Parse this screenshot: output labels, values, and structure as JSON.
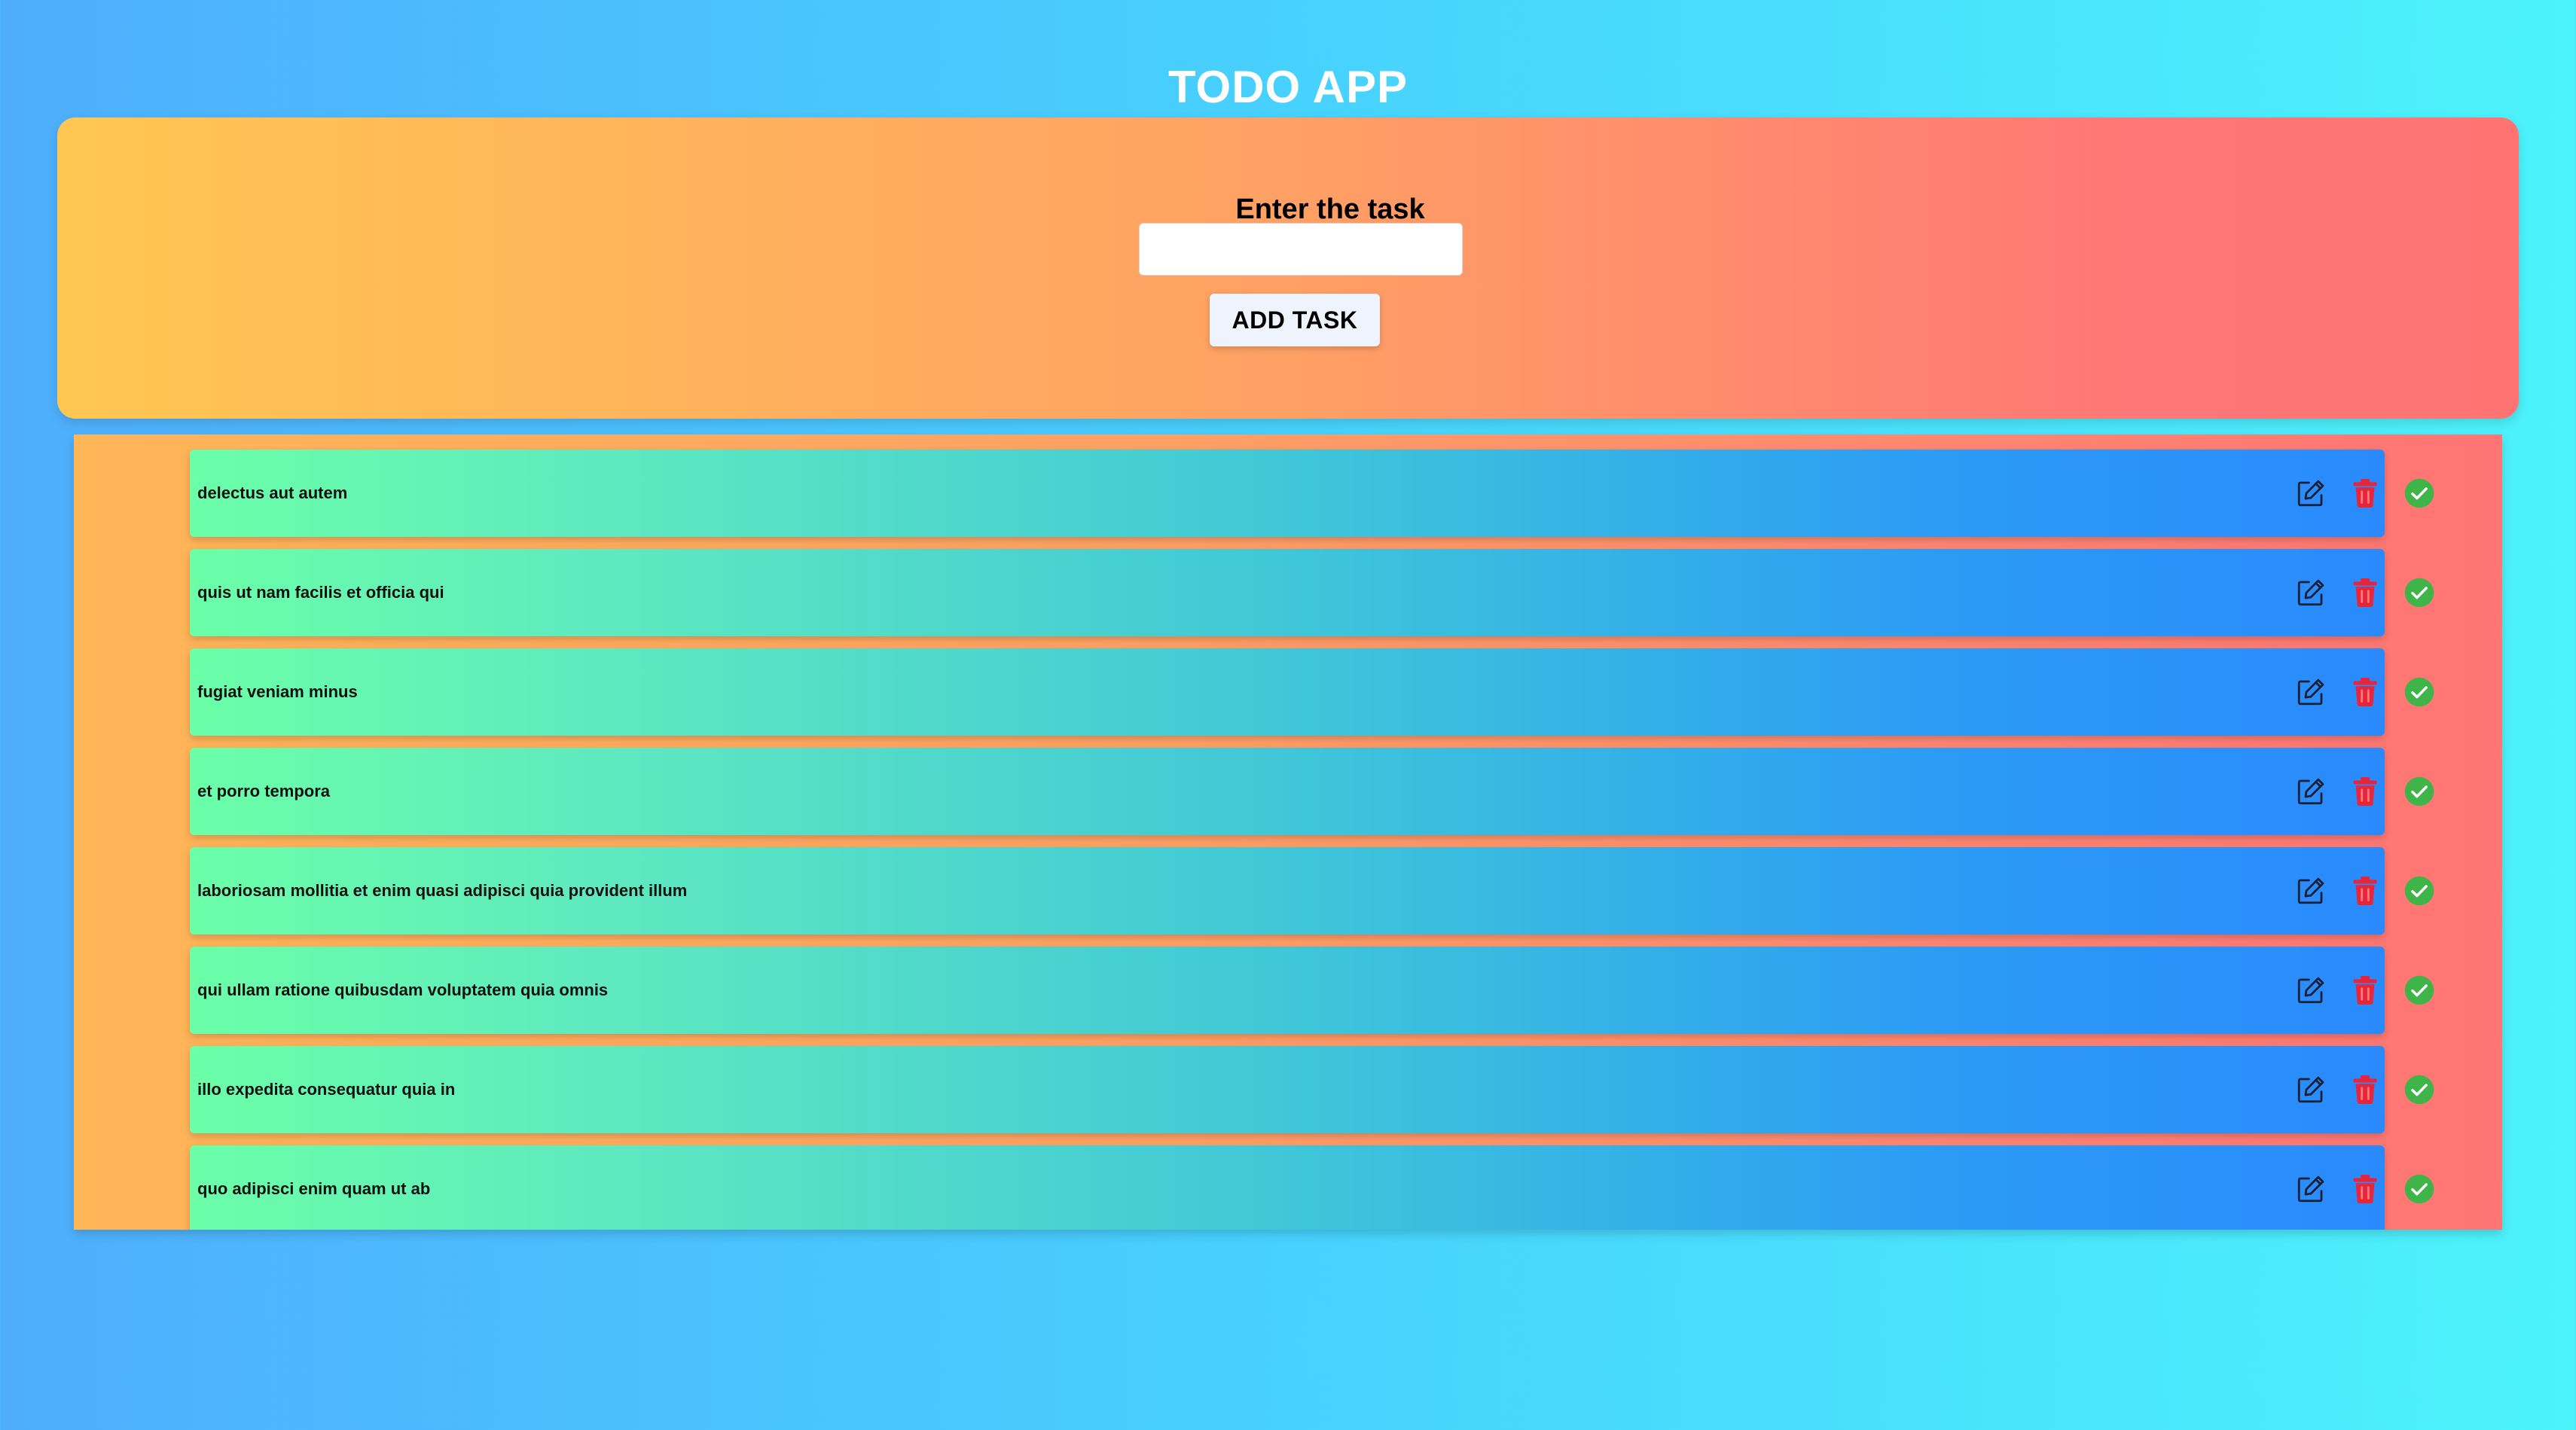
{
  "app": {
    "title": "TODO APP"
  },
  "form": {
    "label": "Enter the task",
    "input_value": "",
    "add_button_label": "ADD TASK"
  },
  "tasks": [
    {
      "text": "delectus aut autem"
    },
    {
      "text": "quis ut nam facilis et officia qui"
    },
    {
      "text": "fugiat veniam minus"
    },
    {
      "text": "et porro tempora"
    },
    {
      "text": "laboriosam mollitia et enim quasi adipisci quia provident illum"
    },
    {
      "text": "qui ullam ratione quibusdam voluptatem quia omnis"
    },
    {
      "text": "illo expedita consequatur quia in"
    },
    {
      "text": "quo adipisci enim quam ut ab"
    }
  ],
  "icons": {
    "edit": "edit-icon",
    "delete": "trash-icon",
    "complete": "check-circle-icon"
  },
  "colors": {
    "delete": "#e8243a",
    "complete": "#3fb549",
    "edit": "#1a1f36"
  }
}
